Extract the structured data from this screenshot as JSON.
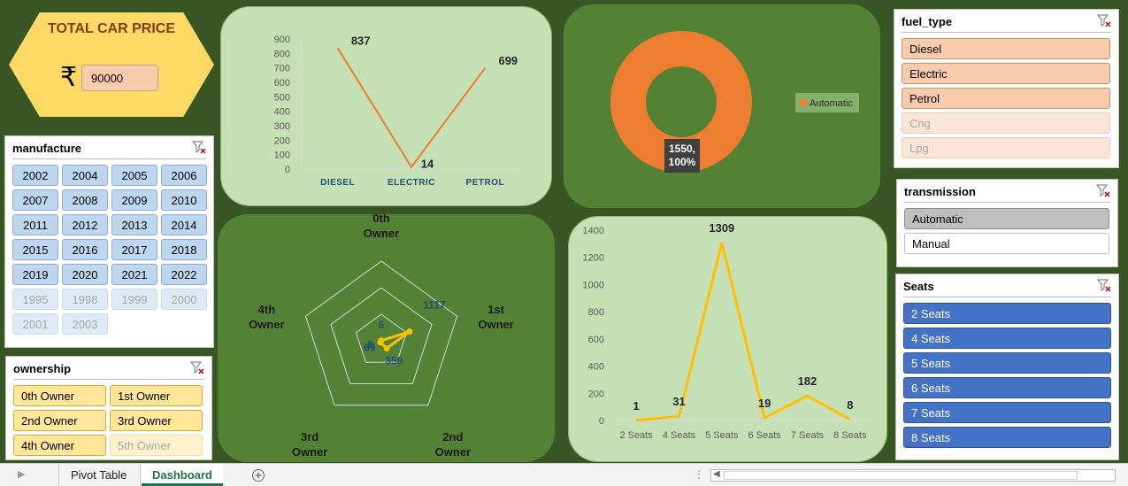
{
  "price_card": {
    "title": "TOTAL CAR PRICE",
    "currency_symbol": "₹",
    "value": "90000"
  },
  "manufacture": {
    "title": "manufacture",
    "years_selected": [
      "2002",
      "2004",
      "2005",
      "2006",
      "2007",
      "2008",
      "2009",
      "2010",
      "2011",
      "2012",
      "2013",
      "2014",
      "2015",
      "2016",
      "2017",
      "2018",
      "2019",
      "2020",
      "2021",
      "2022"
    ],
    "years_unselected": [
      "1995",
      "1998",
      "1999",
      "2000",
      "2001",
      "2003"
    ]
  },
  "ownership": {
    "title": "ownership",
    "selected": [
      "0th Owner",
      "1st Owner",
      "2nd Owner",
      "3rd Owner",
      "4th Owner"
    ],
    "unselected": [
      "5th Owner"
    ]
  },
  "fuel_type": {
    "title": "fuel_type",
    "selected": [
      "Diesel",
      "Electric",
      "Petrol"
    ],
    "unselected": [
      "Cng",
      "Lpg"
    ]
  },
  "transmission": {
    "title": "transmission",
    "selected": [
      "Automatic"
    ],
    "unselected": [
      "Manual"
    ]
  },
  "seats": {
    "title": "Seats",
    "selected": [
      "2 Seats",
      "4 Seats",
      "5 Seats",
      "6 Seats",
      "7 Seats",
      "8 Seats"
    ]
  },
  "tabs": {
    "pivot": "Pivot Table",
    "dashboard": "Dashboard"
  },
  "colors": {
    "orange": "#ed7d31",
    "gold": "#ffc000",
    "blue": "#1f4e79",
    "bg": "#375623"
  },
  "chart_data": [
    {
      "type": "line",
      "categories": [
        "DIESEL",
        "ELECTRIC",
        "PETROL"
      ],
      "values": [
        837,
        14,
        699
      ],
      "ylim": [
        0,
        900
      ],
      "yticks": [
        0,
        100,
        200,
        300,
        400,
        500,
        600,
        700,
        800,
        900
      ],
      "grid": false
    },
    {
      "type": "pie",
      "categories": [
        "Automatic"
      ],
      "values": [
        1550
      ],
      "data_label": "1550,\n100%",
      "legend": "right"
    },
    {
      "type": "line",
      "subtype": "radar",
      "categories": [
        "0th Owner",
        "1st Owner",
        "2nd Owner",
        "3rd Owner",
        "4th Owner"
      ],
      "values": [
        6,
        1117,
        350,
        69,
        8
      ],
      "max": 3000
    },
    {
      "type": "line",
      "categories": [
        "2 Seats",
        "4 Seats",
        "5 Seats",
        "6 Seats",
        "7 Seats",
        "8 Seats"
      ],
      "values": [
        1,
        31,
        1309,
        19,
        182,
        8
      ],
      "ylim": [
        0,
        1400
      ],
      "yticks": [
        0,
        200,
        400,
        600,
        800,
        1000,
        1200,
        1400
      ],
      "grid": false
    }
  ]
}
